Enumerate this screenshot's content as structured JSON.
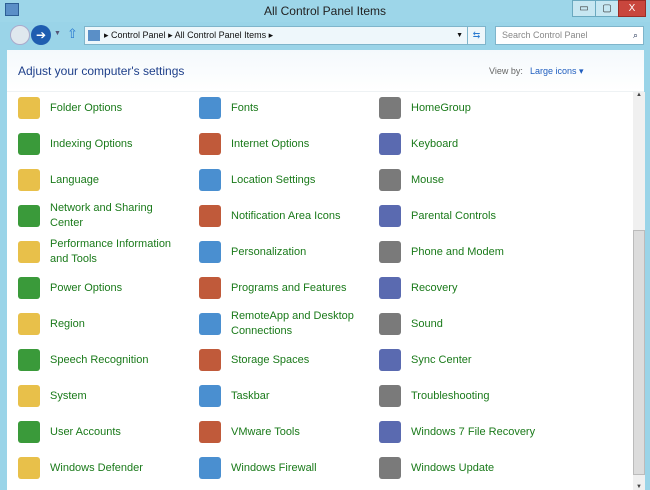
{
  "window": {
    "title": "All Control Panel Items",
    "minimize": "▭",
    "maximize": "▢",
    "close": "X"
  },
  "nav": {
    "breadcrumb": [
      "Control Panel",
      "All Control Panel Items"
    ],
    "search_placeholder": "Search Control Panel"
  },
  "header": {
    "title": "Adjust your computer's settings",
    "view_by_label": "View by:",
    "view_by_value": "Large icons"
  },
  "items": [
    [
      "Folder Options",
      "Fonts",
      "HomeGroup"
    ],
    [
      "Indexing Options",
      "Internet Options",
      "Keyboard"
    ],
    [
      "Language",
      "Location Settings",
      "Mouse"
    ],
    [
      "Network and Sharing Center",
      "Notification Area Icons",
      "Parental Controls"
    ],
    [
      "Performance Information and Tools",
      "Personalization",
      "Phone and Modem"
    ],
    [
      "Power Options",
      "Programs and Features",
      "Recovery"
    ],
    [
      "Region",
      "RemoteApp and Desktop Connections",
      "Sound"
    ],
    [
      "Speech Recognition",
      "Storage Spaces",
      "Sync Center"
    ],
    [
      "System",
      "Taskbar",
      "Troubleshooting"
    ],
    [
      "User Accounts",
      "VMware Tools",
      "Windows 7 File Recovery"
    ],
    [
      "Windows Defender",
      "Windows Firewall",
      "Windows Update"
    ]
  ],
  "icon_colors": [
    "#e8c04a",
    "#4a8fd0",
    "#7a7a7a",
    "#3a9a3a",
    "#c05a3a",
    "#5a6ab0"
  ]
}
